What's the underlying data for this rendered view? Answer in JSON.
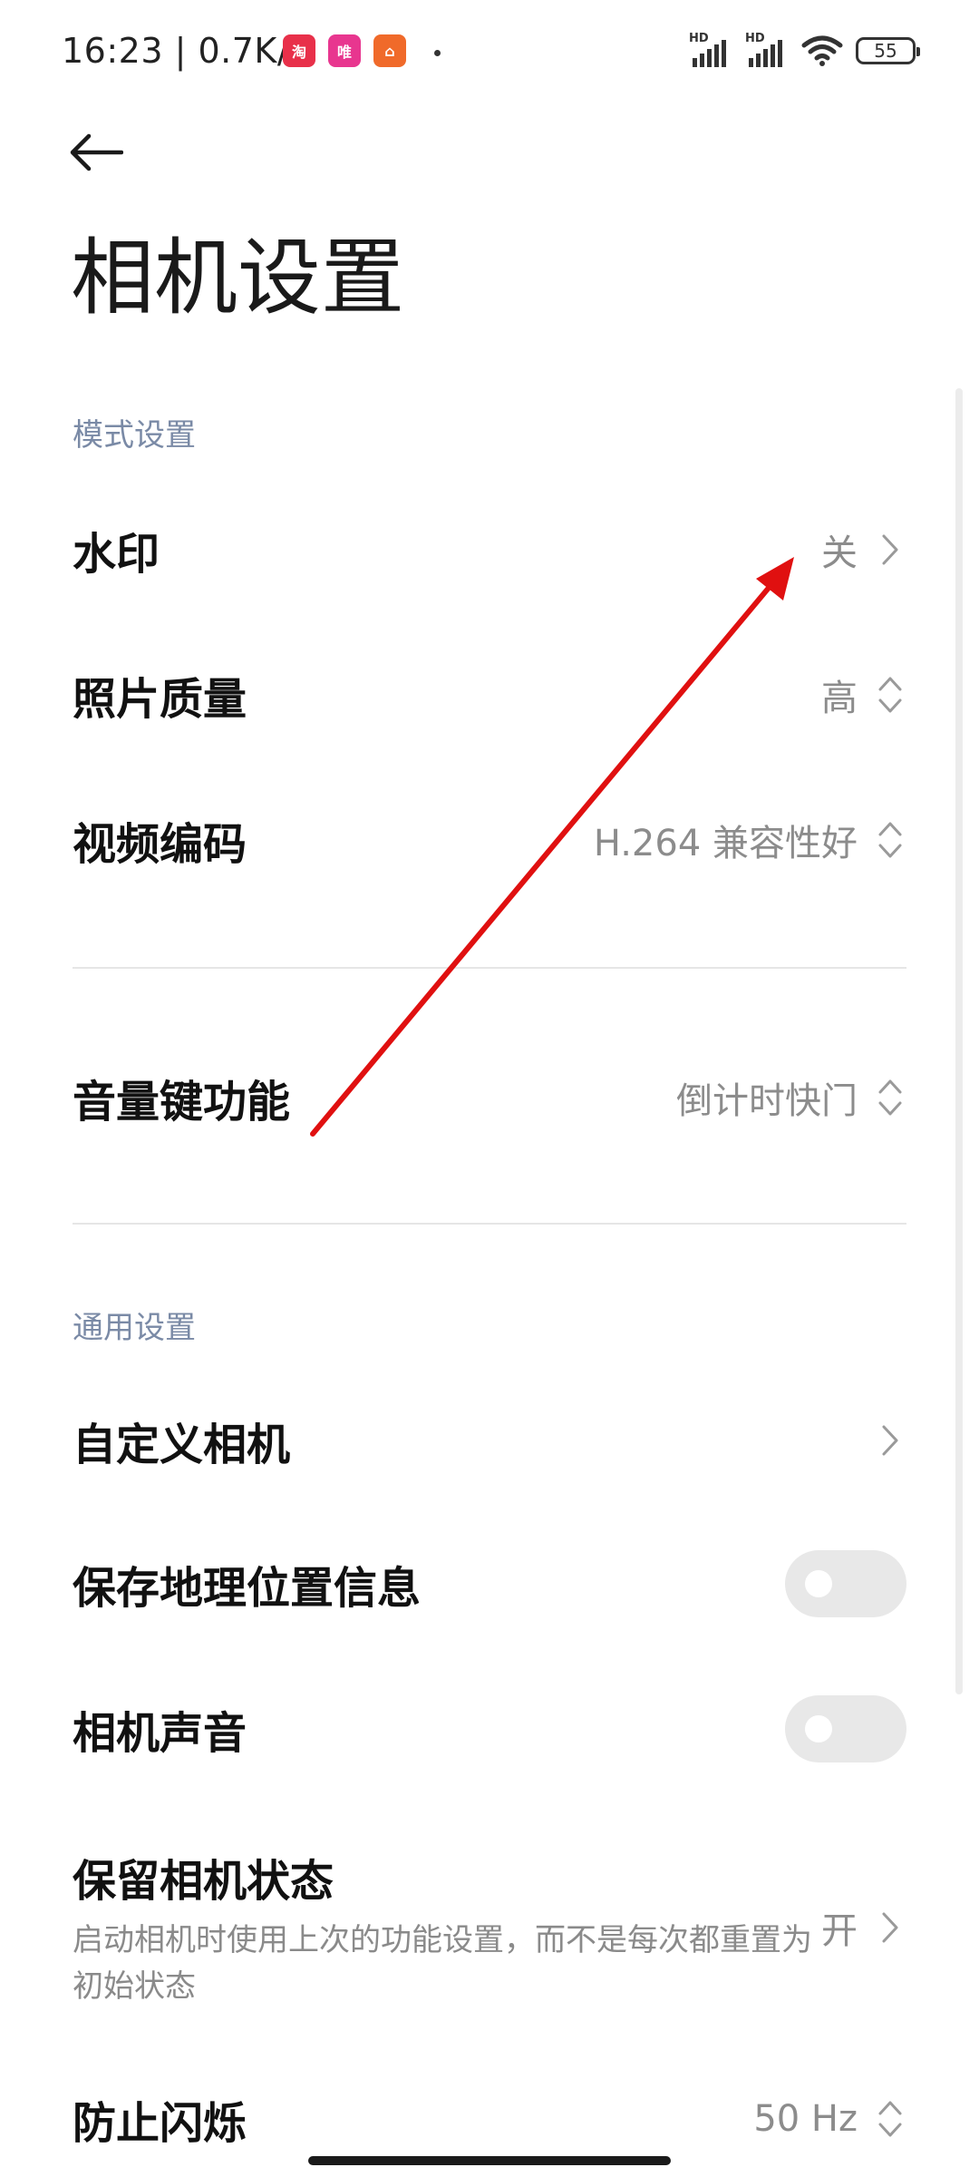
{
  "status_bar": {
    "time_speed": "16:23 | 0.7K/s",
    "signal1_badge": "HD",
    "signal2_badge": "HD",
    "battery": "55",
    "app_icons": [
      {
        "name": "shopping-app-red-icon",
        "color": "#e8304a"
      },
      {
        "name": "vip-app-pink-icon",
        "color": "#e8368f"
      },
      {
        "name": "home-app-orange-icon",
        "color": "#f06a2a"
      }
    ]
  },
  "header": {
    "title": "相机设置"
  },
  "sections": {
    "mode_settings": "模式设置",
    "general_settings": "通用设置"
  },
  "items": {
    "watermark": {
      "label": "水印",
      "value": "关"
    },
    "photo_quality": {
      "label": "照片质量",
      "value": "高"
    },
    "video_codec": {
      "label": "视频编码",
      "value": "H.264 兼容性好"
    },
    "volume_key": {
      "label": "音量键功能",
      "value": "倒计时快门"
    },
    "custom_camera": {
      "label": "自定义相机"
    },
    "save_location": {
      "label": "保存地理位置信息",
      "enabled": false
    },
    "camera_sound": {
      "label": "相机声音",
      "enabled": false
    },
    "keep_state": {
      "label": "保留相机状态",
      "description": "启动相机时使用上次的功能设置，而不是每次都重置为初始状态",
      "value": "开"
    },
    "anti_flicker": {
      "label": "防止闪烁",
      "value": "50 Hz"
    }
  },
  "colors": {
    "annotation_arrow": "#e01010",
    "section_header": "#7a8aa6",
    "value_text": "#8c8c8c"
  }
}
